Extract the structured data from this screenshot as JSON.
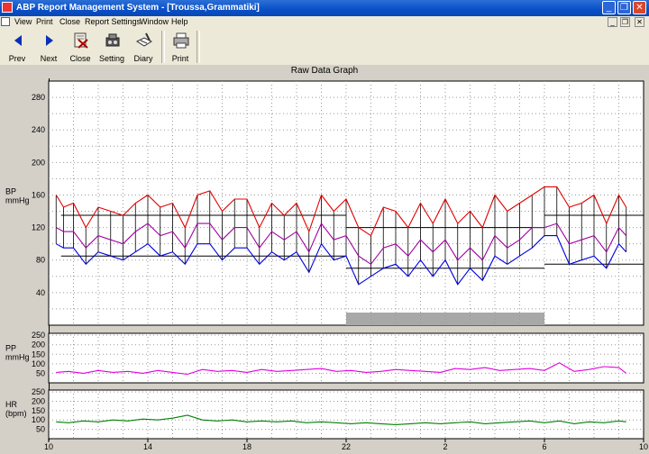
{
  "window": {
    "title": "ABP Report Management System - [Troussa,Grammatiki]",
    "controls": {
      "minimize": "_",
      "restore": "❐",
      "close": "✕"
    }
  },
  "menu": {
    "items": [
      "View",
      "Print",
      "Close",
      "Report Settings",
      "Window",
      "Help"
    ],
    "mdi_controls": {
      "minimize": "_",
      "restore": "❐",
      "close": "✕"
    }
  },
  "toolbar": {
    "buttons": [
      {
        "label": "Prev",
        "icon": "left-arrow-icon"
      },
      {
        "label": "Next",
        "icon": "right-arrow-icon"
      },
      {
        "label": "Close",
        "icon": "close-document-icon"
      },
      {
        "label": "Setting",
        "icon": "setting-icon"
      },
      {
        "label": "Diary",
        "icon": "diary-icon"
      },
      {
        "label": "Print",
        "icon": "printer-icon"
      }
    ]
  },
  "graph": {
    "title": "Raw Data Graph"
  },
  "colors": {
    "systolic": "#e00000",
    "map": "#a000a0",
    "diastolic": "#0000e0",
    "pp": "#e000e0",
    "hr": "#008000",
    "night": "#a8a8a8"
  },
  "chart_data": [
    {
      "type": "line",
      "name": "bp-panel",
      "ylabel": "BP\nmmHg",
      "ylabel_lines": [
        "BP",
        "mmHg"
      ],
      "yticks": [
        40,
        80,
        120,
        160,
        200,
        240,
        280
      ],
      "ylim": [
        0,
        300
      ],
      "xlim": [
        10,
        34
      ],
      "grid": true,
      "thresholds": [
        {
          "x_start": 10.5,
          "x_end": 22,
          "value": 135
        },
        {
          "x_start": 10.5,
          "x_end": 22,
          "value": 85
        },
        {
          "x_start": 22,
          "x_end": 30,
          "value": 120
        },
        {
          "x_start": 22,
          "x_end": 30,
          "value": 70
        },
        {
          "x_start": 30,
          "x_end": 34,
          "value": 135
        },
        {
          "x_start": 30,
          "x_end": 34,
          "value": 75
        }
      ],
      "night_period": [
        22,
        30
      ],
      "series": [
        {
          "key": "systolic",
          "x": [
            10.3,
            10.6,
            11,
            11.5,
            12,
            12.5,
            13,
            13.5,
            14,
            14.5,
            15,
            15.5,
            16,
            16.5,
            17,
            17.5,
            18,
            18.5,
            19,
            19.5,
            20,
            20.5,
            21,
            21.5,
            22,
            22.5,
            23,
            23.5,
            24,
            24.5,
            25,
            25.5,
            26,
            26.5,
            27,
            27.5,
            28,
            28.5,
            29,
            29.5,
            30,
            30.5,
            31,
            31.5,
            32,
            32.5,
            33,
            33.3
          ],
          "values": [
            160,
            145,
            150,
            120,
            145,
            140,
            135,
            150,
            160,
            145,
            150,
            120,
            160,
            165,
            140,
            155,
            155,
            120,
            150,
            135,
            150,
            115,
            160,
            140,
            155,
            120,
            110,
            145,
            140,
            120,
            150,
            125,
            155,
            125,
            140,
            120,
            160,
            140,
            150,
            160,
            170,
            170,
            145,
            150,
            160,
            125,
            160,
            145
          ]
        },
        {
          "key": "map",
          "x": [
            10.3,
            10.6,
            11,
            11.5,
            12,
            12.5,
            13,
            13.5,
            14,
            14.5,
            15,
            15.5,
            16,
            16.5,
            17,
            17.5,
            18,
            18.5,
            19,
            19.5,
            20,
            20.5,
            21,
            21.5,
            22,
            22.5,
            23,
            23.5,
            24,
            24.5,
            25,
            25.5,
            26,
            26.5,
            27,
            27.5,
            28,
            28.5,
            29,
            29.5,
            30,
            30.5,
            31,
            31.5,
            32,
            32.5,
            33,
            33.3
          ],
          "values": [
            120,
            115,
            115,
            95,
            110,
            105,
            100,
            115,
            125,
            110,
            115,
            95,
            125,
            125,
            105,
            120,
            120,
            95,
            115,
            105,
            115,
            90,
            125,
            105,
            110,
            85,
            75,
            95,
            100,
            85,
            105,
            90,
            105,
            80,
            95,
            80,
            110,
            95,
            105,
            120,
            120,
            125,
            100,
            105,
            110,
            90,
            120,
            110
          ]
        },
        {
          "key": "diastolic",
          "x": [
            10.3,
            10.6,
            11,
            11.5,
            12,
            12.5,
            13,
            13.5,
            14,
            14.5,
            15,
            15.5,
            16,
            16.5,
            17,
            17.5,
            18,
            18.5,
            19,
            19.5,
            20,
            20.5,
            21,
            21.5,
            22,
            22.5,
            23,
            23.5,
            24,
            24.5,
            25,
            25.5,
            26,
            26.5,
            27,
            27.5,
            28,
            28.5,
            29,
            29.5,
            30,
            30.5,
            31,
            31.5,
            32,
            32.5,
            33,
            33.3
          ],
          "values": [
            100,
            95,
            95,
            75,
            90,
            85,
            80,
            90,
            100,
            85,
            90,
            75,
            100,
            100,
            80,
            95,
            95,
            75,
            90,
            80,
            90,
            65,
            100,
            80,
            85,
            50,
            60,
            70,
            75,
            60,
            80,
            60,
            80,
            50,
            70,
            55,
            85,
            75,
            85,
            95,
            110,
            110,
            75,
            80,
            85,
            70,
            100,
            90
          ]
        }
      ]
    },
    {
      "type": "line",
      "name": "pp-panel",
      "ylabel_lines": [
        "PP",
        "mmHg"
      ],
      "yticks": [
        50,
        100,
        150,
        200,
        250
      ],
      "ylim": [
        0,
        260
      ],
      "xlim": [
        10,
        34
      ],
      "grid": true,
      "series": [
        {
          "key": "pp",
          "x": [
            10.3,
            10.8,
            11.4,
            12,
            12.6,
            13.2,
            13.8,
            14.4,
            15,
            15.6,
            16.2,
            16.8,
            17.4,
            18,
            18.6,
            19.2,
            19.8,
            20.4,
            21,
            21.6,
            22.2,
            22.8,
            23.4,
            24,
            24.6,
            25.2,
            25.8,
            26.4,
            27,
            27.6,
            28.2,
            28.8,
            29.4,
            30,
            30.6,
            31.2,
            31.8,
            32.4,
            33,
            33.3
          ],
          "values": [
            55,
            60,
            50,
            65,
            55,
            60,
            50,
            65,
            55,
            45,
            70,
            60,
            65,
            55,
            70,
            60,
            65,
            70,
            75,
            60,
            65,
            55,
            60,
            70,
            65,
            60,
            55,
            75,
            70,
            80,
            65,
            70,
            75,
            65,
            105,
            60,
            70,
            85,
            80,
            50
          ]
        }
      ]
    },
    {
      "type": "line",
      "name": "hr-panel",
      "ylabel_lines": [
        "HR",
        "(bpm)"
      ],
      "yticks": [
        50,
        100,
        150,
        200,
        250
      ],
      "ylim": [
        0,
        260
      ],
      "xlim": [
        10,
        34
      ],
      "xticks": [
        10,
        14,
        18,
        22,
        2,
        6,
        10
      ],
      "xtick_positions": [
        10,
        14,
        18,
        22,
        26,
        30,
        34
      ],
      "grid": true,
      "series": [
        {
          "key": "hr",
          "x": [
            10.3,
            10.8,
            11.4,
            12,
            12.6,
            13.2,
            13.8,
            14.4,
            15,
            15.6,
            16.2,
            16.8,
            17.4,
            18,
            18.6,
            19.2,
            19.8,
            20.4,
            21,
            21.6,
            22.2,
            22.8,
            23.4,
            24,
            24.6,
            25.2,
            25.8,
            26.4,
            27,
            27.6,
            28.2,
            28.8,
            29.4,
            30,
            30.6,
            31.2,
            31.8,
            32.4,
            33,
            33.3
          ],
          "values": [
            90,
            85,
            95,
            90,
            100,
            95,
            105,
            100,
            110,
            125,
            100,
            95,
            100,
            90,
            95,
            90,
            95,
            85,
            90,
            85,
            80,
            85,
            80,
            75,
            80,
            85,
            80,
            85,
            90,
            80,
            85,
            90,
            95,
            85,
            95,
            80,
            90,
            85,
            95,
            90
          ]
        }
      ]
    }
  ]
}
